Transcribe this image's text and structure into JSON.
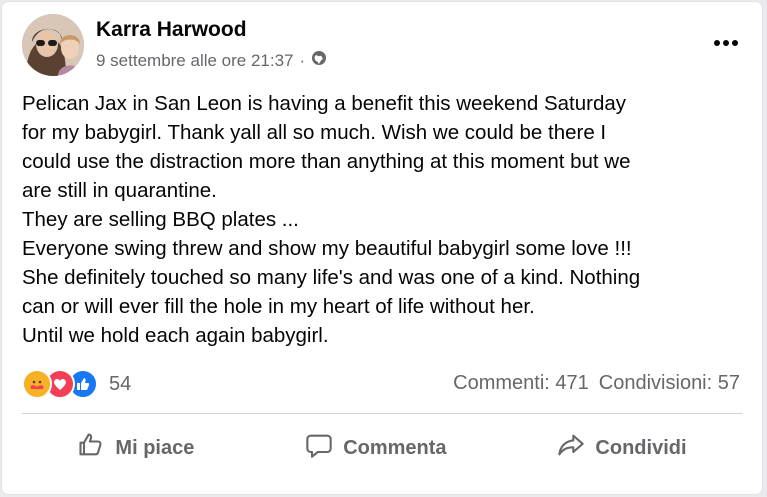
{
  "post": {
    "author": "Karra Harwood",
    "timestamp": "9 settembre alle ore 21:37",
    "separator": "·",
    "privacy_icon": "globe-icon",
    "more_icon": "more-horizontal-icon",
    "text_lines": [
      "Pelican Jax in San Leon is having a benefit this weekend Saturday",
      "for my babygirl. Thank yall all so much. Wish we could be there I",
      "could use the distraction more than anything at this moment but we",
      "are still in quarantine.",
      "They are selling BBQ plates ...",
      "Everyone swing threw and show my beautiful babygirl some love !!!",
      "She definitely touched so many life's and was one of a kind. Nothing",
      "can or will ever fill the hole in my heart of life without her.",
      "Until we hold each again babygirl."
    ]
  },
  "stats": {
    "reaction_icons": [
      "care-reaction-icon",
      "love-reaction-icon",
      "like-reaction-icon"
    ],
    "reaction_count": "54",
    "comments": "Commenti: 471",
    "shares": "Condivisioni: 57"
  },
  "actions": {
    "like": "Mi piace",
    "comment": "Commenta",
    "share": "Condividi"
  },
  "colors": {
    "text": "#050505",
    "secondary": "#65676b",
    "like_blue": "#1877f2",
    "love_red": "#f33e58",
    "care_yellow": "#f7b125"
  }
}
